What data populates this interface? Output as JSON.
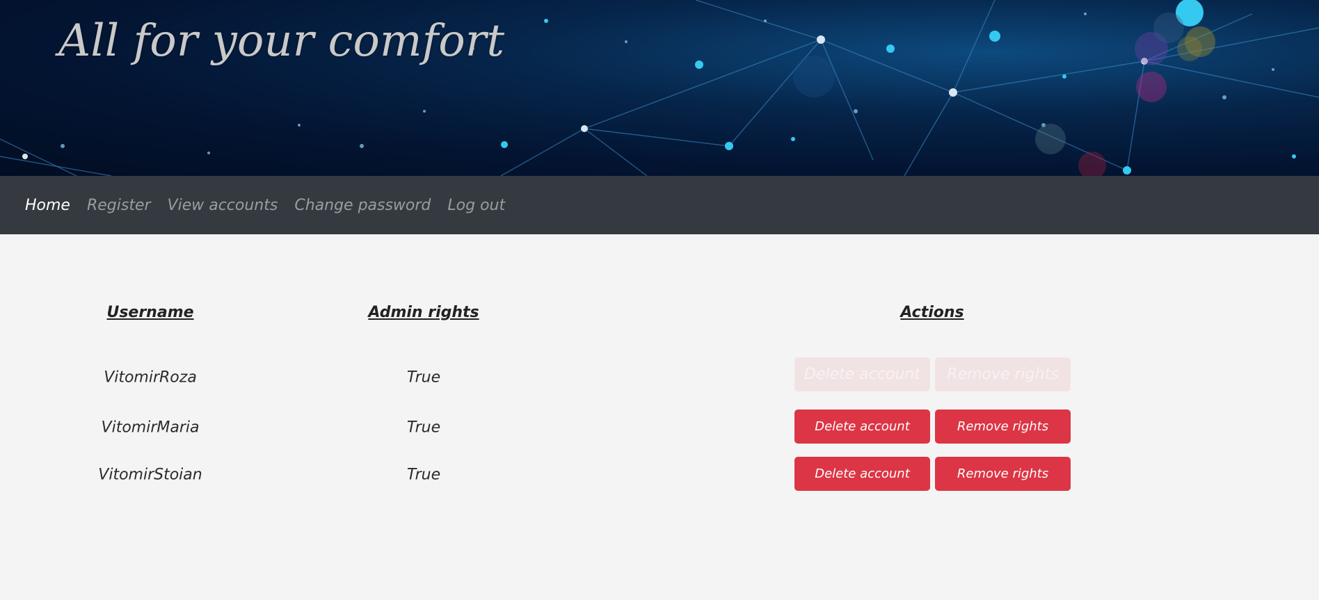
{
  "banner": {
    "title": "All for your comfort"
  },
  "nav": {
    "items": [
      {
        "label": "Home",
        "active": true
      },
      {
        "label": "Register",
        "active": false
      },
      {
        "label": "View accounts",
        "active": false
      },
      {
        "label": "Change password",
        "active": false
      },
      {
        "label": "Log out",
        "active": false
      }
    ]
  },
  "table": {
    "headers": {
      "username": "Username",
      "admin_rights": "Admin rights",
      "actions": "Actions"
    },
    "rows": [
      {
        "username": "VitomirRoza",
        "admin": "True",
        "delete_label": "Delete account",
        "remove_label": "Remove rights",
        "disabled": true
      },
      {
        "username": "VitomirMaria",
        "admin": "True",
        "delete_label": "Delete account",
        "remove_label": "Remove rights",
        "disabled": false
      },
      {
        "username": "VitomirStoian",
        "admin": "True",
        "delete_label": "Delete account",
        "remove_label": "Remove rights",
        "disabled": false
      }
    ]
  },
  "colors": {
    "navbar": "#343a40",
    "danger": "#dc3545",
    "page_background": "#f4f4f4"
  }
}
